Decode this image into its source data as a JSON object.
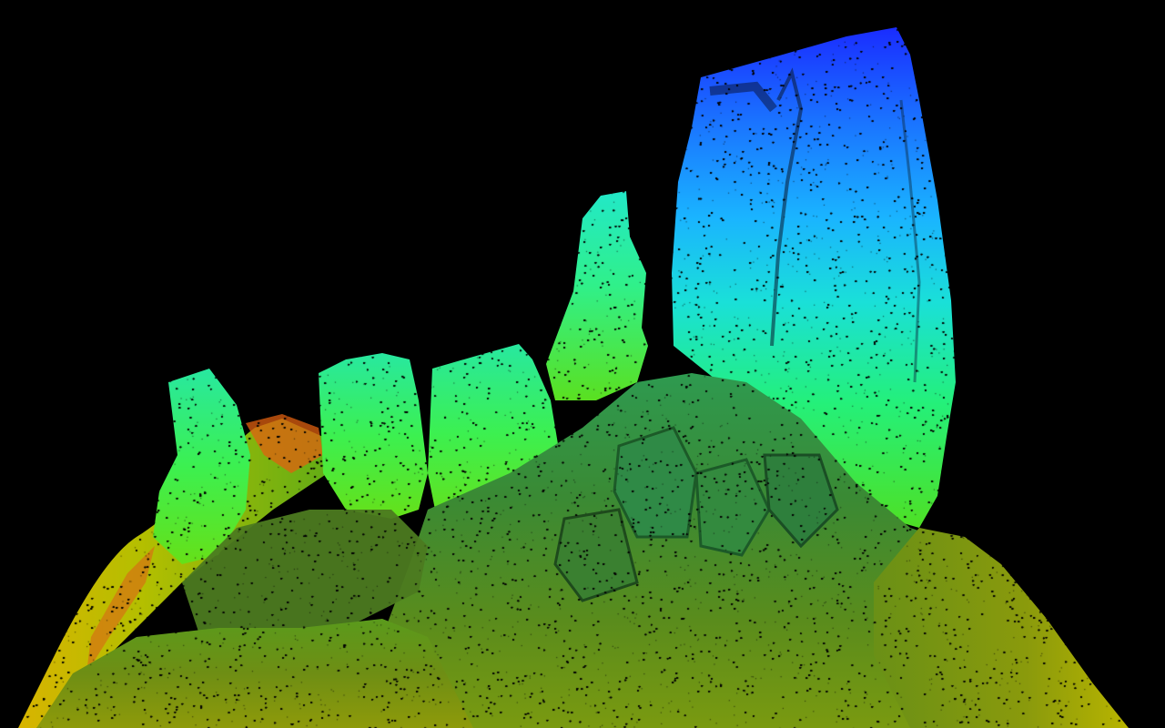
{
  "scene": {
    "subject": "lidar-point-cloud-rock-formation",
    "colormap": "elevation-jet",
    "colors": {
      "background": "#000000",
      "top": "#1a2cff",
      "upper": "#1a9cff",
      "upper_mid": "#1ad8e0",
      "mid": "#24f06a",
      "lower_mid": "#3ad81a",
      "ground": "#4c8a1e",
      "low": "#b8c800",
      "bottom": "#f0c800",
      "edge": "#ff5a00"
    }
  }
}
